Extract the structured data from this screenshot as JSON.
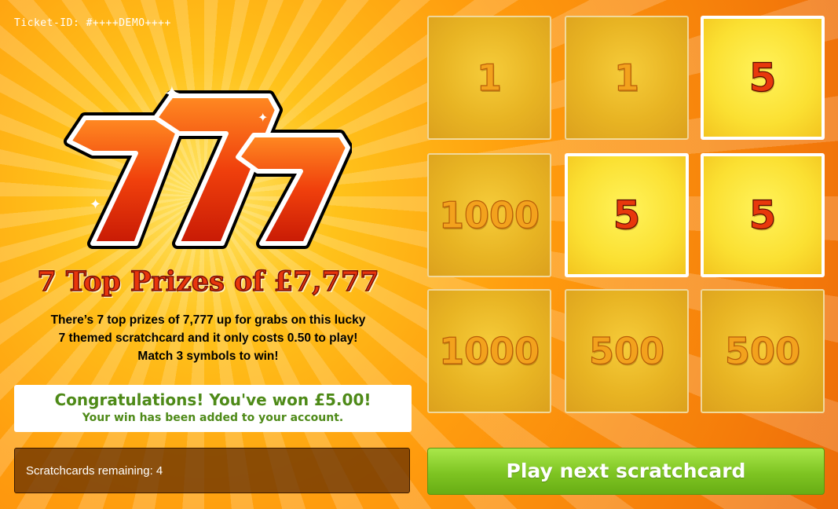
{
  "ticket": {
    "label": "Ticket-ID: #++++DEMO++++"
  },
  "logo": {
    "text": "777"
  },
  "headline": "7 Top Prizes of £7,777",
  "description": {
    "line1": "There’s 7 top prizes of 7,777 up for grabs on this lucky",
    "line2": "7 themed scratchcard and it only costs 0.50 to play!",
    "line3": "Match 3 symbols to win!"
  },
  "result": {
    "title": "Congratulations! You've won £5.00!",
    "subtitle": "Your win has been added to your account."
  },
  "remaining": {
    "label": "Scratchcards remaining: 4"
  },
  "grid": {
    "cells": [
      {
        "value": "1",
        "win": false
      },
      {
        "value": "1",
        "win": false
      },
      {
        "value": "5",
        "win": true
      },
      {
        "value": "1000",
        "win": false
      },
      {
        "value": "5",
        "win": true
      },
      {
        "value": "5",
        "win": true
      },
      {
        "value": "1000",
        "win": false
      },
      {
        "value": "500",
        "win": false
      },
      {
        "value": "500",
        "win": false
      }
    ]
  },
  "play_button": {
    "label": "Play next scratchcard"
  },
  "colors": {
    "win_text": "#e8380c",
    "button_green": "#7ec422",
    "message_green": "#4e8a18"
  }
}
